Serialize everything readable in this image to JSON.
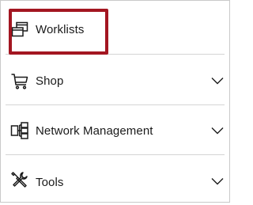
{
  "menu": {
    "items": [
      {
        "label": "Worklists",
        "icon": "stacked-windows-icon",
        "expandable": false,
        "highlighted": true
      },
      {
        "label": "Shop",
        "icon": "shopping-cart-icon",
        "expandable": true
      },
      {
        "label": "Network Management",
        "icon": "network-diagram-icon",
        "expandable": true
      },
      {
        "label": "Tools",
        "icon": "wrench-screwdriver-icon",
        "expandable": true
      }
    ]
  },
  "colors": {
    "highlight_border": "#a31621",
    "separator": "#d4d4d4",
    "text": "#1a1a1a"
  }
}
